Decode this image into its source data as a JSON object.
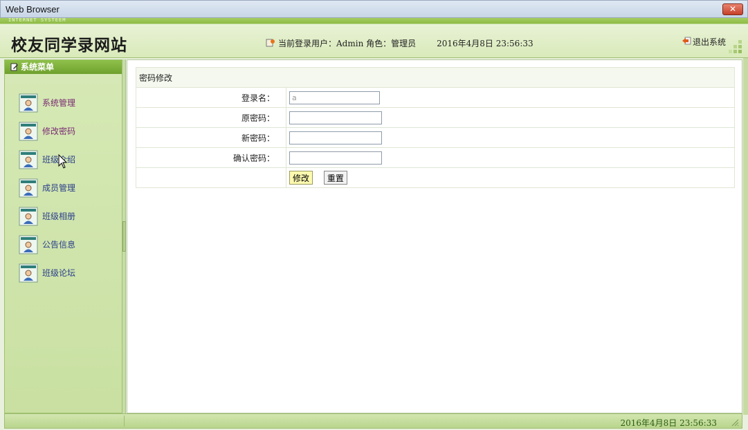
{
  "window": {
    "title": "Web Browser",
    "close_icon": "close-icon"
  },
  "header": {
    "tagline": "INTERNET SYSTEEM",
    "site_title": "校友同学录网站",
    "user_label": "当前登录用户：Admin 角色：管理员",
    "datetime": "2016年4月8日  23:56:33",
    "logout_label": "退出系统"
  },
  "sidebar": {
    "title": "系统菜单",
    "items": [
      {
        "label": "系统管理",
        "icon": "user-card-icon"
      },
      {
        "label": "修改密码",
        "icon": "user-card-icon"
      },
      {
        "label": "班级介绍",
        "icon": "user-card-icon"
      },
      {
        "label": "成员管理",
        "icon": "user-card-icon"
      },
      {
        "label": "班级相册",
        "icon": "user-card-icon"
      },
      {
        "label": "公告信息",
        "icon": "user-card-icon"
      },
      {
        "label": "班级论坛",
        "icon": "user-card-icon"
      }
    ]
  },
  "form": {
    "caption": "密码修改",
    "login_label": "登录名：",
    "login_value": "a",
    "old_label": "原密码：",
    "new_label": "新密码：",
    "confirm_label": "确认密码：",
    "submit_label": "修改",
    "reset_label": "重置"
  },
  "footer": {
    "datetime": "2016年4月8日  23:56:33"
  },
  "colors": {
    "accent": "#8dbb45",
    "sidebar_bg": "#d6e9b6",
    "link": "#2a3e8a",
    "visited": "#7a2a72"
  }
}
